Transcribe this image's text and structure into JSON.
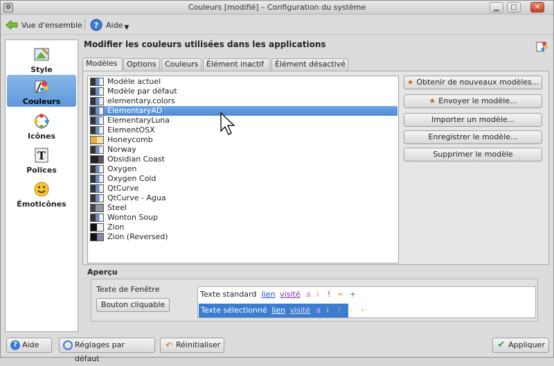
{
  "window": {
    "title": "Couleurs [modifié] – Configuration du système",
    "app_icon": "settings-icon"
  },
  "toolbar": {
    "back_label": "Vue d'ensemble",
    "help_label": "Aide"
  },
  "sidebar": {
    "items": [
      {
        "label": "Style",
        "icon": "style-icon"
      },
      {
        "label": "Couleurs",
        "icon": "colors-icon",
        "selected": true
      },
      {
        "label": "Icônes",
        "icon": "icons-icon"
      },
      {
        "label": "Polices",
        "icon": "fonts-icon"
      },
      {
        "label": "Émoticônes",
        "icon": "emoticons-icon"
      }
    ]
  },
  "main": {
    "heading": "Modifier les couleurs utilisées dans les applications",
    "tabs": [
      "Modèles",
      "Options",
      "Couleurs",
      "Élément inactif",
      "Élément désactivé"
    ],
    "schemes": [
      "Modèle actuel",
      "Modèle par défaut",
      "elementary.colors",
      "ElementaryAD",
      "ElementaryLuna",
      "ElementOSX",
      "Honeycomb",
      "Norway",
      "Obsidian Coast",
      "Oxygen",
      "Oxygen Cold",
      "QtCurve",
      "QtCurve - Agua",
      "Steel",
      "Wonton Soup",
      "Zion",
      "Zion (Reversed)"
    ],
    "selected_scheme": "ElementaryAD",
    "buttons": {
      "get_new": "Obtenir de nouveaux modèles...",
      "send": "Envoyer le modèle...",
      "import": "Importer un modèle...",
      "save": "Enregistrer le modèle...",
      "delete": "Supprimer le modèle"
    },
    "preview": {
      "title": "Aperçu",
      "window_text": "Texte de Fenêtre",
      "button": "Bouton cliquable",
      "standard_text": "Texte standard",
      "selected_text": "Texte sélectionné",
      "link": "lien",
      "visited": "visité",
      "symbols": [
        "a",
        "i",
        "!",
        "=",
        "+"
      ]
    }
  },
  "footer": {
    "help": "Aide",
    "defaults": "Réglages par défaut",
    "reset": "Réinitialiser",
    "apply": "Appliquer"
  },
  "colors": {
    "selection": "#4e88d0",
    "link": "#1c4ed8",
    "visited": "#7c2fb5"
  }
}
